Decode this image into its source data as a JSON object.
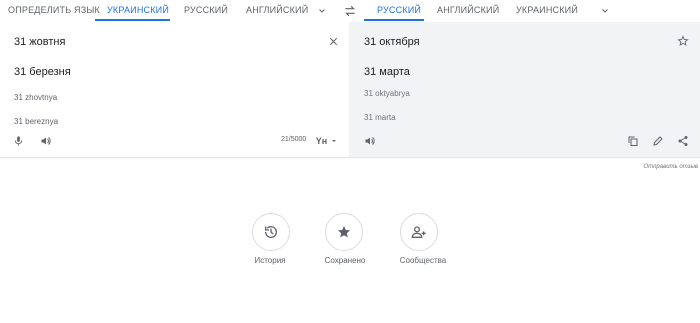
{
  "source_langs": [
    "ОПРЕДЕЛИТЬ ЯЗЫК",
    "УКРАИНСКИЙ",
    "РУССКИЙ",
    "АНГЛИЙСКИЙ"
  ],
  "target_langs": [
    "РУССКИЙ",
    "АНГЛИЙСКИЙ",
    "УКРАИНСКИЙ"
  ],
  "source": {
    "input_text": "31 жовтня",
    "suggestion": "31 березня",
    "translit_1": "31 zhovtnya",
    "translit_2": "31 bereznya",
    "char_count": "21/5000"
  },
  "target": {
    "translation": "31 октября",
    "suggestion": "31 марта",
    "translit_1": "31 oktyabrya",
    "translit_2": "31 marta"
  },
  "feedback_link": "Отправить отзыв",
  "bottom": {
    "history": "История",
    "saved": "Сохранено",
    "community": "Сообщества"
  },
  "icons": [
    "chevron-down-icon",
    "swap-icon",
    "close-icon",
    "star-icon",
    "mic-icon",
    "speaker-icon",
    "keyboard-icon",
    "copy-icon",
    "edit-icon",
    "share-icon",
    "history-icon",
    "saved-star-icon",
    "community-icon"
  ],
  "colors": {
    "accent": "#1a73e8",
    "target_bg": "#f1f3f4"
  }
}
